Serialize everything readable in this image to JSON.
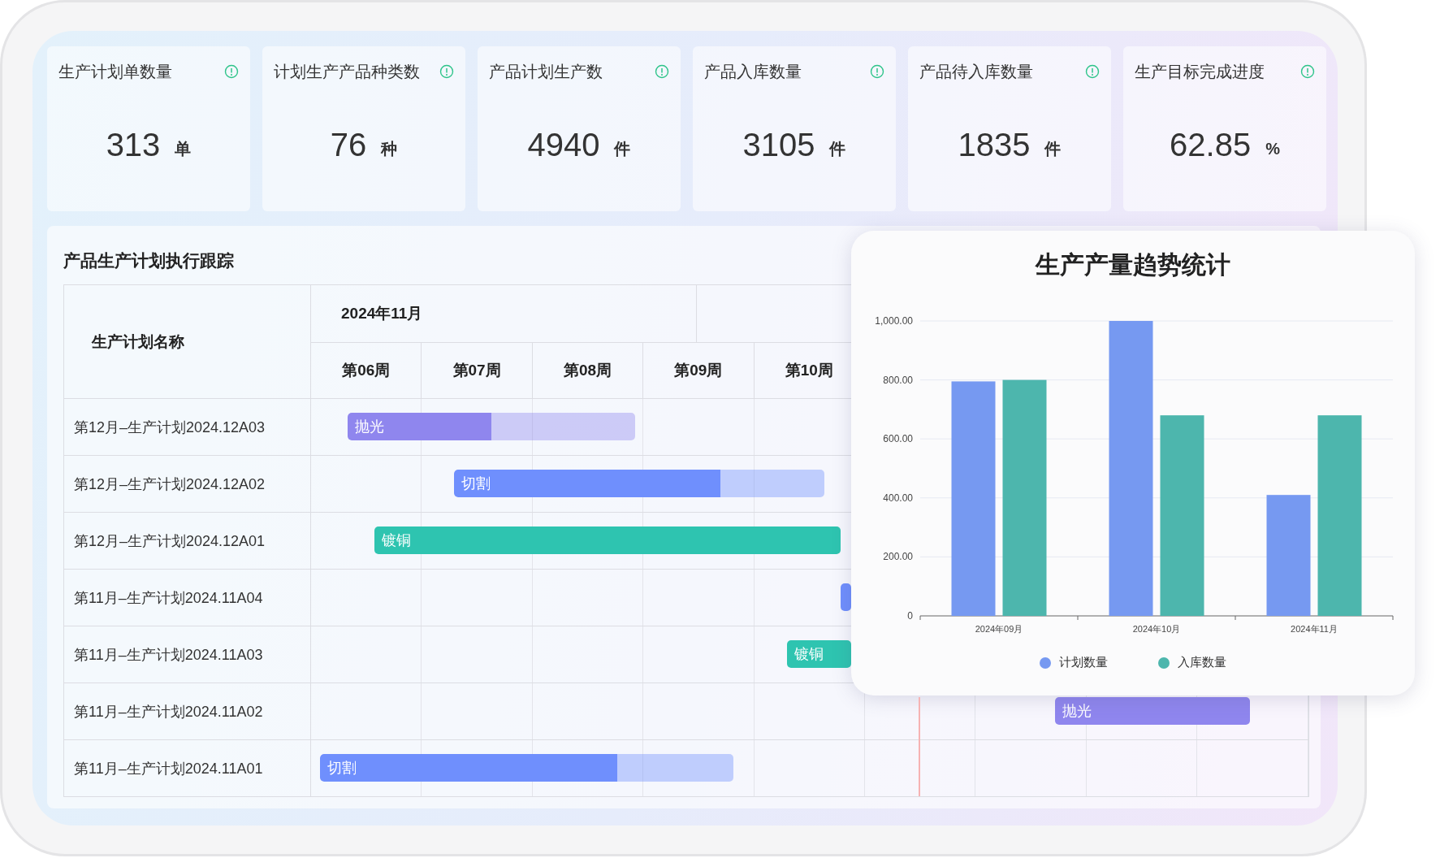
{
  "cards": [
    {
      "title": "生产计划单数量",
      "value": "313",
      "unit": "单"
    },
    {
      "title": "计划生产产品种类数",
      "value": "76",
      "unit": "种"
    },
    {
      "title": "产品计划生产数",
      "value": "4940",
      "unit": "件"
    },
    {
      "title": "产品入库数量",
      "value": "3105",
      "unit": "件"
    },
    {
      "title": "产品待入库数量",
      "value": "1835",
      "unit": "件"
    },
    {
      "title": "生产目标完成进度",
      "value": "62.85",
      "unit": "%"
    }
  ],
  "tracking": {
    "title": "产品生产计划执行跟踪",
    "name_header": "生产计划名称",
    "month": "2024年11月",
    "weeks": [
      "第06周",
      "第07周",
      "第08周",
      "第09周",
      "第10周"
    ],
    "rows": [
      {
        "name": "第12月–生产计划2024.12A03",
        "bar": {
          "label": "抛光",
          "color": "#8f86ee",
          "level": 0.5
        }
      },
      {
        "name": "第12月–生产计划2024.12A02",
        "bar": {
          "label": "切割",
          "color": "#6f8ffd",
          "level": 0.72
        }
      },
      {
        "name": "第12月–生产计划2024.12A01",
        "bar": {
          "label": "镀铜",
          "color": "#2ec4b0"
        }
      },
      {
        "name": "第11月–生产计划2024.11A04",
        "bar": {
          "color": "#6f8ffd"
        }
      },
      {
        "name": "第11月–生产计划2024.11A03",
        "bar": {
          "label": "镀铜",
          "color": "#2ec4b0"
        }
      },
      {
        "name": "第11月–生产计划2024.11A02",
        "bar": {
          "label": "抛光",
          "color": "#8f86ee"
        }
      },
      {
        "name": "第11月–生产计划2024.11A01",
        "bar": {
          "label": "切割",
          "color": "#6f8ffd",
          "level": 0.72
        }
      }
    ]
  },
  "chart_card": {
    "title": "生产产量趋势统计",
    "chart_data": {
      "type": "bar",
      "categories": [
        "2024年09月",
        "2024年10月",
        "2024年11月"
      ],
      "series": [
        {
          "name": "计划数量",
          "color": "#7699f1",
          "values": [
            795,
            1000,
            410
          ]
        },
        {
          "name": "入库数量",
          "color": "#4db6ad",
          "values": [
            800,
            680,
            680
          ]
        }
      ],
      "ylim": [
        0,
        1000
      ],
      "grid": true,
      "yticks": [
        {
          "value": 0,
          "label": "0"
        },
        {
          "value": 200,
          "label": "200.00"
        },
        {
          "value": 400,
          "label": "400.00"
        },
        {
          "value": 600,
          "label": "600.00"
        },
        {
          "value": 800,
          "label": "800.00"
        },
        {
          "value": 1000,
          "label": "1,000.00"
        }
      ]
    }
  }
}
